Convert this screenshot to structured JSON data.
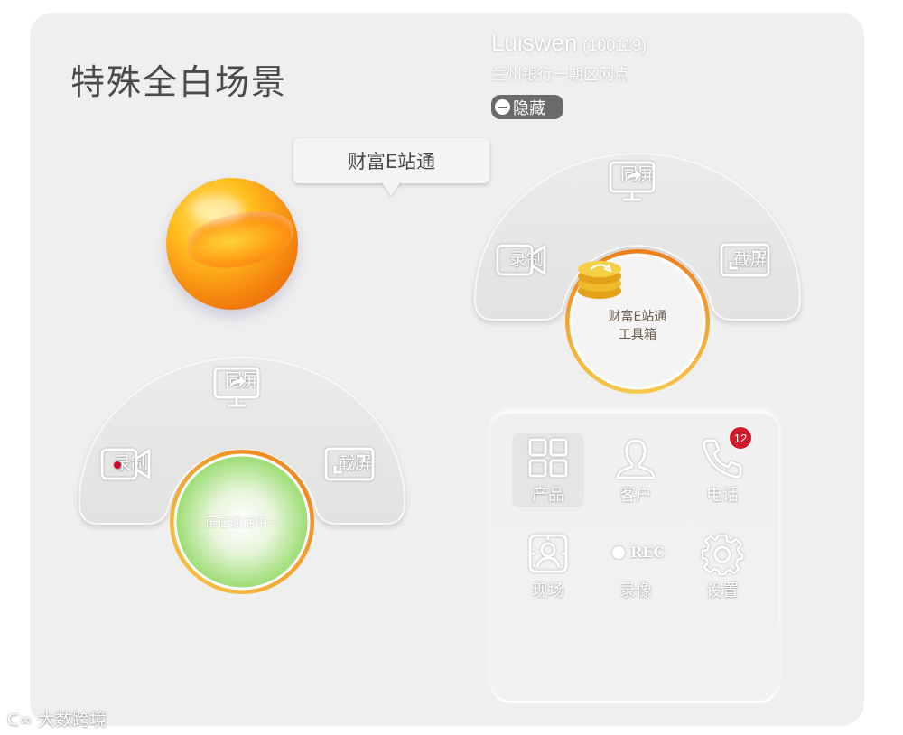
{
  "page": {
    "title": "特殊全白场景"
  },
  "user": {
    "name": "Luiswen",
    "id": "(100119)",
    "branch": "兰州银行一期区网点",
    "hide_label": "隐藏"
  },
  "tooltip": {
    "label": "财富E站通"
  },
  "toolbox_widget": {
    "items": [
      {
        "label": "同屏",
        "icon": "screen-share-icon"
      },
      {
        "label": "录制",
        "icon": "video-camera-icon"
      },
      {
        "label": "截屏",
        "icon": "screenshot-icon"
      }
    ],
    "center_line1": "财富E站通",
    "center_line2": "工具箱",
    "center_icon": "coin-stack-icon"
  },
  "call_widget": {
    "items": [
      {
        "label": "同屏",
        "icon": "screen-share-icon"
      },
      {
        "label": "录制",
        "icon": "video-camera-recording-icon"
      },
      {
        "label": "截屏",
        "icon": "screenshot-icon"
      }
    ],
    "status": "正在通话中···"
  },
  "app_panel": {
    "items": [
      {
        "label": "产品",
        "icon": "grid-icon",
        "selected": true
      },
      {
        "label": "客户",
        "icon": "person-icon"
      },
      {
        "label": "电话",
        "icon": "phone-icon",
        "badge": "12"
      },
      {
        "label": "现场",
        "icon": "site-camera-icon"
      },
      {
        "label": "录像",
        "icon": "rec-icon",
        "rec_text": "REC"
      },
      {
        "label": "设置",
        "icon": "gear-icon"
      }
    ]
  },
  "watermark": {
    "text": "大数跨境"
  },
  "colors": {
    "panel_bg": "#efefef",
    "ring_orange": "#f08a18",
    "ring_yellow": "#f5c64a",
    "call_green": "#a6df7e",
    "badge_red": "#d21a2a",
    "hide_button": "#6a6a6a"
  }
}
